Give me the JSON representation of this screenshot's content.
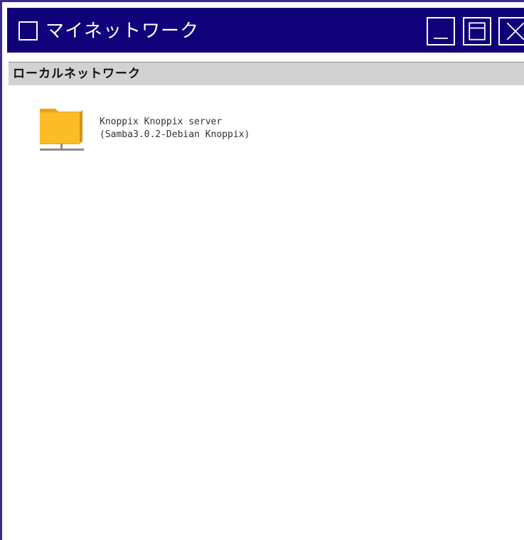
{
  "window": {
    "title": "マイネットワーク",
    "controls": {
      "minimize_icon": "minimize-icon",
      "maximize_icon": "maximize-icon",
      "close_icon": "close-icon"
    },
    "colors": {
      "titlebar": "#10007a",
      "border": "#3a2a92",
      "pathbar": "#d2d2d2",
      "folder": "#fbbc25"
    }
  },
  "location": {
    "label": "ローカルネットワーク"
  },
  "items": [
    {
      "icon": "network-folder-icon",
      "line1": "Knoppix Knoppix server",
      "line2": "(Samba3.0.2-Debian Knoppix)"
    }
  ]
}
